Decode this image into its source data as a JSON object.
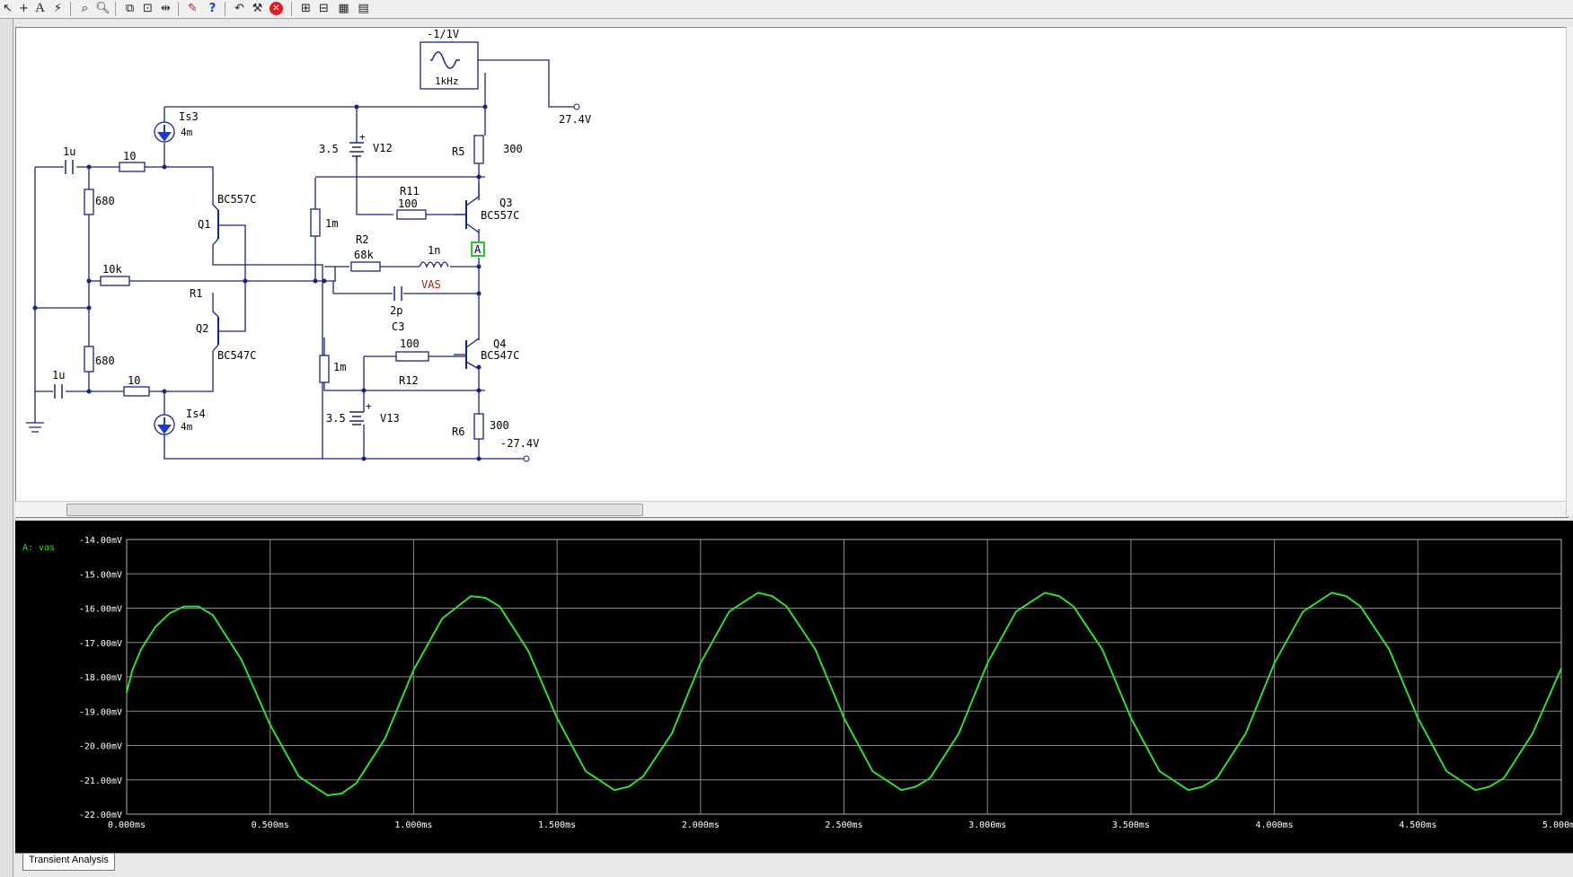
{
  "toolbar": {
    "icons": [
      "pointer-icon",
      "wire-icon",
      "text-icon",
      "probe-icon",
      "zoom-area-icon",
      "zoom-icon",
      "zoom-fit-icon",
      "zoom-prev-icon",
      "mirror-icon",
      "analysis-icon",
      "help-icon",
      "undo-icon",
      "tools-icon",
      "stop-icon",
      "graph-icon",
      "bode-icon",
      "scope-icon",
      "spectrum-icon"
    ],
    "labels": {
      "text": "A",
      "wire": "+",
      "help": "?",
      "stop": "✕"
    }
  },
  "schematic": {
    "source_amp": "-1/1V",
    "source_freq": "1kHz",
    "rail_pos": "27.4V",
    "rail_neg": "-27.4V",
    "is3_name": "Is3",
    "is3_val": "4m",
    "is4_name": "Is4",
    "is4_val": "4m",
    "c_in_top": "1u",
    "c_in_bot": "1u",
    "r_top_10": "10",
    "r_bot_10": "10",
    "r_680_top": "680",
    "r_680_bot": "680",
    "r_10k": "10k",
    "r1_name": "R1",
    "q1_name": "Q1",
    "q1_type": "BC557C",
    "q2_name": "Q2",
    "q2_type": "BC547C",
    "v12_val": "3.5",
    "v12_name": "V12",
    "v13_val": "3.5",
    "v13_name": "V13",
    "r_1m_top": "1m",
    "r_1m_bot": "1m",
    "r11_name": "R11",
    "r11_val": "100",
    "r12_name": "R12",
    "r12_val": "100",
    "r2_name": "R2",
    "r2_val": "68k",
    "l_val": "1n",
    "vas_label": "VAS",
    "c3_val": "2p",
    "c3_name": "C3",
    "r5_name": "R5",
    "r5_val": "300",
    "r6_name": "R6",
    "r6_val": "300",
    "q3_name": "Q3",
    "q3_type": "BC557C",
    "q4_name": "Q4",
    "q4_type": "BC547C",
    "probe_label": "A",
    "plus": "+"
  },
  "tabs": [
    "Transient Analysis"
  ],
  "colors": {
    "trace": "#33dd33",
    "grid": "#8a8a8a",
    "vas": "#9b1c1c",
    "probe_box": "#22cc22",
    "source": "#1a3ad6"
  },
  "chart_data": {
    "type": "line",
    "series": [
      {
        "name": "A: vas"
      }
    ],
    "ylabel_ticks": [
      "-14.00mV",
      "-15.00mV",
      "-16.00mV",
      "-17.00mV",
      "-18.00mV",
      "-19.00mV",
      "-20.00mV",
      "-21.00mV",
      "-22.00mV"
    ],
    "xlabel_ticks": [
      "0.000ms",
      "0.500ms",
      "1.000ms",
      "1.500ms",
      "2.000ms",
      "2.500ms",
      "3.000ms",
      "3.500ms",
      "4.000ms",
      "4.500ms",
      "5.000ms"
    ],
    "xlim": [
      0,
      5.0
    ],
    "ylim": [
      -22.0,
      -14.0
    ],
    "x_unit": "ms",
    "y_unit": "mV",
    "grid": true,
    "x": [
      0.0,
      0.02,
      0.05,
      0.1,
      0.15,
      0.2,
      0.25,
      0.3,
      0.4,
      0.5,
      0.6,
      0.7,
      0.75,
      0.8,
      0.9,
      1.0,
      1.1,
      1.2,
      1.25,
      1.3,
      1.4,
      1.5,
      1.6,
      1.7,
      1.75,
      1.8,
      1.9,
      2.0,
      2.1,
      2.2,
      2.25,
      2.3,
      2.4,
      2.5,
      2.6,
      2.7,
      2.75,
      2.8,
      2.9,
      3.0,
      3.1,
      3.2,
      3.25,
      3.3,
      3.4,
      3.5,
      3.6,
      3.7,
      3.75,
      3.8,
      3.9,
      4.0,
      4.1,
      4.2,
      4.25,
      4.3,
      4.4,
      4.5,
      4.6,
      4.7,
      4.75,
      4.8,
      4.9,
      5.0
    ],
    "values": [
      -18.45,
      -17.8,
      -17.2,
      -16.55,
      -16.15,
      -15.95,
      -15.95,
      -16.2,
      -17.5,
      -19.4,
      -20.9,
      -21.45,
      -21.4,
      -21.1,
      -19.8,
      -17.8,
      -16.3,
      -15.65,
      -15.7,
      -15.95,
      -17.25,
      -19.2,
      -20.75,
      -21.3,
      -21.2,
      -20.9,
      -19.65,
      -17.6,
      -16.1,
      -15.55,
      -15.65,
      -15.95,
      -17.2,
      -19.2,
      -20.75,
      -21.3,
      -21.2,
      -20.95,
      -19.65,
      -17.6,
      -16.1,
      -15.55,
      -15.65,
      -15.95,
      -17.2,
      -19.2,
      -20.75,
      -21.3,
      -21.2,
      -20.95,
      -19.65,
      -17.6,
      -16.1,
      -15.55,
      -15.65,
      -15.95,
      -17.2,
      -19.2,
      -20.75,
      -21.3,
      -21.2,
      -20.95,
      -19.65,
      -17.75
    ]
  }
}
